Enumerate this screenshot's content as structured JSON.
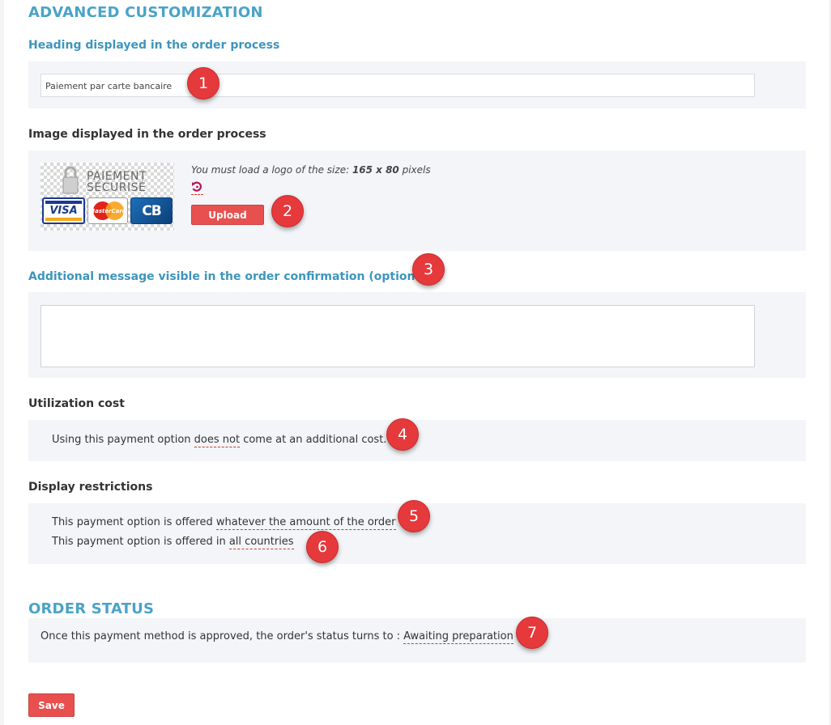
{
  "advanced": {
    "title": "ADVANCED CUSTOMIZATION",
    "heading_label": "Heading displayed in the order process",
    "heading_value": "Paiement par carte bancaire",
    "image_label": "Image displayed in the order process",
    "logo": {
      "line1": "PAIEMENT",
      "line2": "SÉCURISÉ",
      "cards": [
        "VISA",
        "MasterCard",
        "CB"
      ]
    },
    "logo_hint_prefix": "You must load a logo of the size: ",
    "logo_hint_size": "165 x 80",
    "logo_hint_suffix": " pixels",
    "upload_label": "Upload",
    "message_label": "Additional message visible in the order confirmation (optional)",
    "message_value": ""
  },
  "cost": {
    "label": "Utilization cost",
    "text_before": "Using this payment option ",
    "link": "does not",
    "text_after": " come at an additional cost."
  },
  "restrictions": {
    "label": "Display restrictions",
    "amount_prefix": "This payment option is offered ",
    "amount_link": "whatever the amount of the order",
    "countries_prefix": "This payment option is offered in ",
    "countries_link": "all countries"
  },
  "order_status": {
    "title": "ORDER STATUS",
    "text": "Once this payment method is approved, the order's status turns to : ",
    "status_link": "Awaiting preparation"
  },
  "save_label": "Save",
  "markers": [
    "1",
    "2",
    "3",
    "4",
    "5",
    "6",
    "7"
  ],
  "colors": {
    "accent_blue": "#4aa3c7",
    "button_red": "#e8504f",
    "marker_red": "#e5393b",
    "panel_bg": "#f3f5f8"
  },
  "icons": {
    "reset": "reset-icon",
    "lock": "padlock-icon",
    "resize": "resize-handle-icon"
  }
}
